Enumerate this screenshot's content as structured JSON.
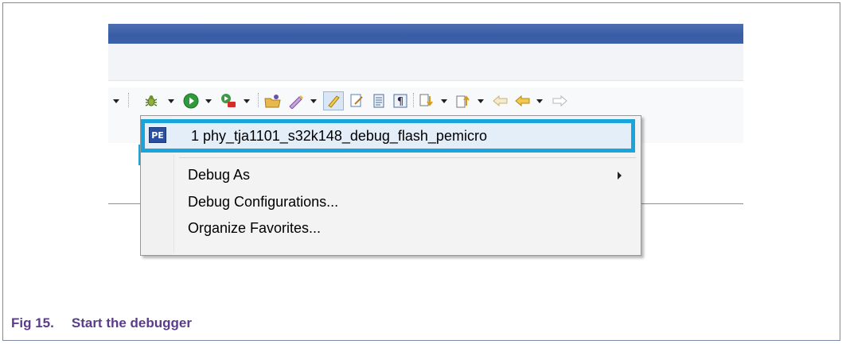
{
  "menu": {
    "recent_item": "1 phy_tja1101_s32k148_debug_flash_pemicro",
    "debug_as": "Debug As",
    "debug_configurations": "Debug Configurations...",
    "organize_favorites": "Organize Favorites..."
  },
  "caption": {
    "number": "Fig 15.",
    "text": "Start the debugger"
  },
  "colors": {
    "highlight": "#1aa4dc",
    "caption": "#5a3c8c",
    "titlebar": "#3a60a9"
  },
  "icons": [
    "debug-bug-icon",
    "run-icon",
    "external-tools-icon",
    "open-folder-icon",
    "pencil-icon",
    "page-edit-icon",
    "document-icon",
    "pilcrow-icon",
    "next-annotation-icon",
    "previous-annotation-icon",
    "back-arrow-icon",
    "forward-arrow-icon",
    "pemicro-icon",
    "submenu-arrow-icon"
  ]
}
